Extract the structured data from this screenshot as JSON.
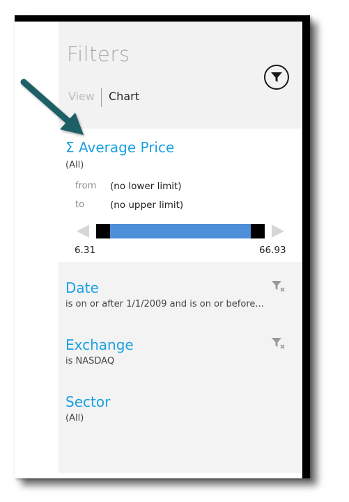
{
  "panel": {
    "title": "Filters",
    "tabs": {
      "view": "View",
      "chart": "Chart",
      "active": "Chart"
    },
    "filter_button_icon": "funnel-icon"
  },
  "average_price": {
    "title": "Σ Average Price",
    "subtitle": "(All)",
    "from_label": "from",
    "from_value": "(no lower limit)",
    "to_label": "to",
    "to_value": "(no upper limit)",
    "slider_min": "6.31",
    "slider_max": "66.93",
    "slider_color": "#4f8fd9"
  },
  "filters": [
    {
      "title": "Date",
      "subtitle": "is on or after 1/1/2009 and is on or before...",
      "clear_icon": "clear-filter-icon"
    },
    {
      "title": "Exchange",
      "subtitle": "is NASDAQ",
      "clear_icon": "clear-filter-icon"
    },
    {
      "title": "Sector",
      "subtitle": "(All)"
    }
  ],
  "colors": {
    "accent": "#1ba1e2",
    "callout_arrow": "#1f5f66"
  }
}
